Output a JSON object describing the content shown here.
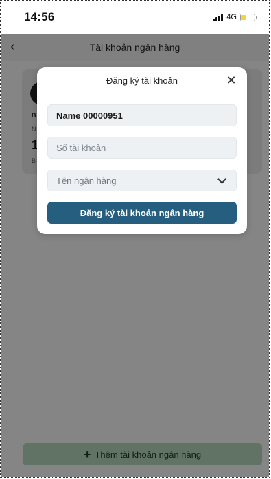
{
  "status_bar": {
    "time": "14:56",
    "network": "4G"
  },
  "header": {
    "title": "Tài khoản ngân hàng",
    "back_icon": "‹"
  },
  "card": {
    "line_a": "B",
    "line_b": "N",
    "line_c": "1",
    "line_d": "B"
  },
  "footer": {
    "add_bank_label": "Thêm tài khoản ngân hàng",
    "plus_icon": "+"
  },
  "modal": {
    "title": "Đăng ký tài khoản",
    "close_icon": "✕",
    "name_value": "Name 00000951",
    "account_placeholder": "Số tài khoản",
    "bank_placeholder": "Tên ngân hàng",
    "submit_label": "Đăng ký tài khoản ngân hàng"
  }
}
